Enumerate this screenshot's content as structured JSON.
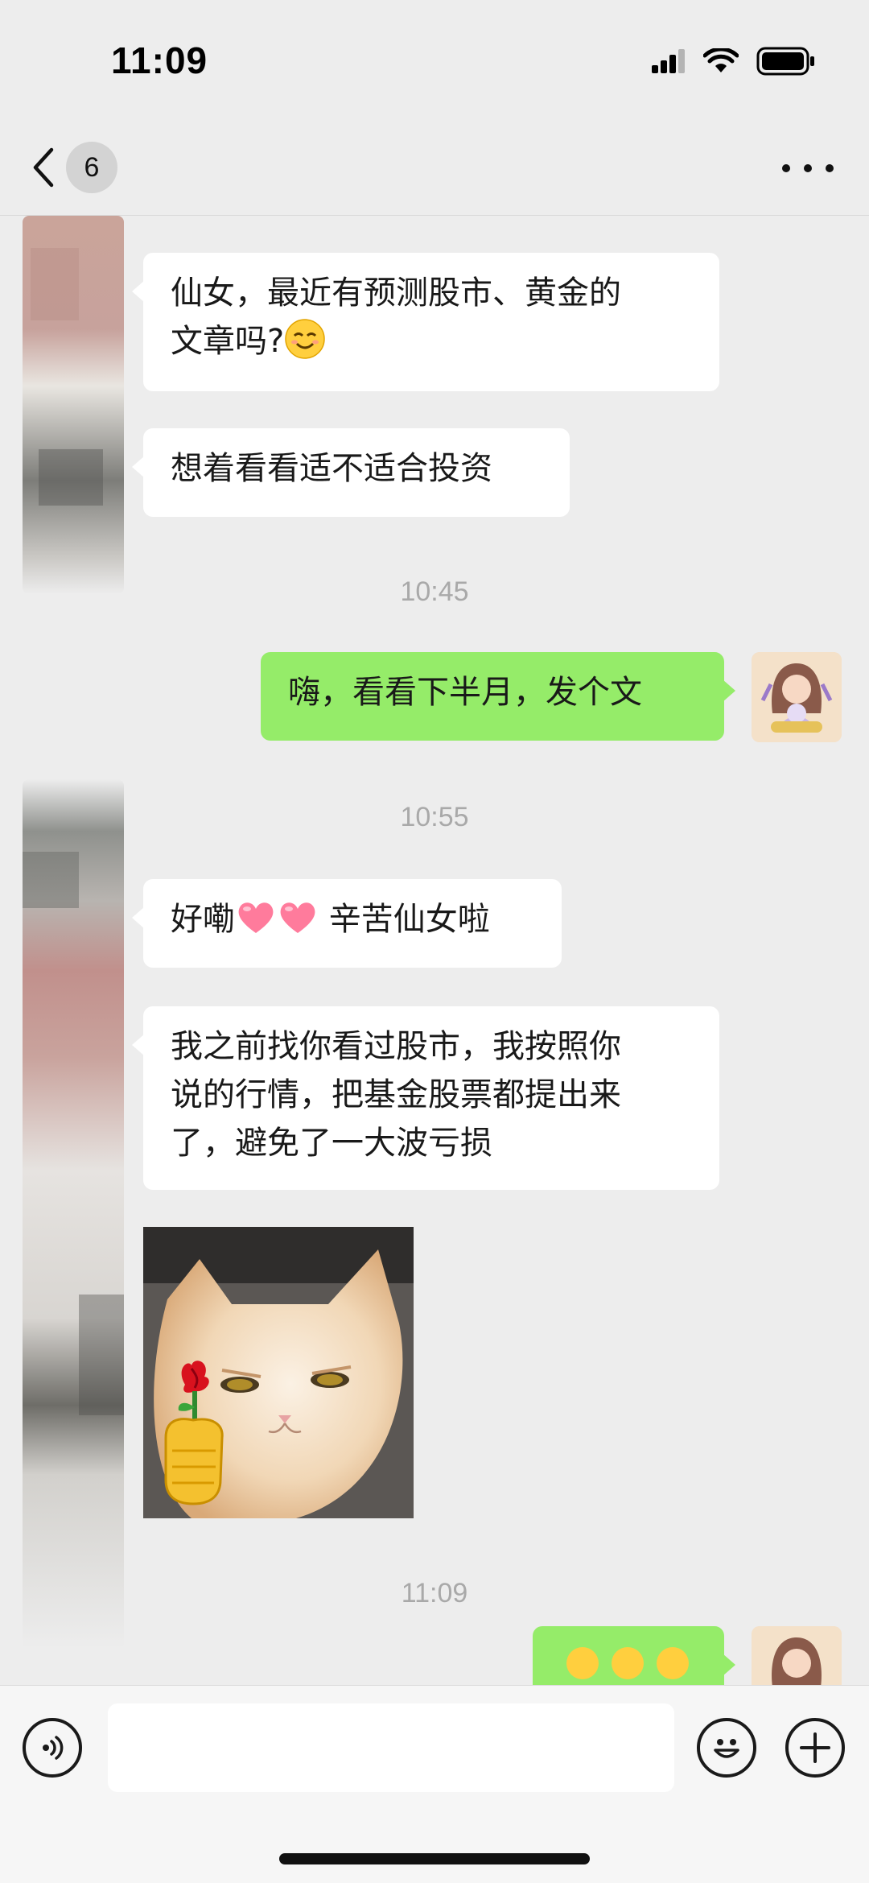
{
  "status_bar": {
    "time": "11:09"
  },
  "nav": {
    "back_count": "6"
  },
  "messages": {
    "m1_line1": "仙女，最近有预测股市、黄金的",
    "m1_line2": "文章吗?",
    "m2": "想着看看适不适合投资",
    "ts1": "10:45",
    "m3": "嗨，看看下半月，发个文",
    "ts2": "10:55",
    "m4_text": "辛苦仙女啦",
    "m4_prefix": "好嘞",
    "m5_line1": "我之前找你看过股市，我按照你",
    "m5_line2": "说的行情，把基金股票都提出来",
    "m5_line3": "了，避免了一大波亏损",
    "ts3": "11:09"
  },
  "input": {
    "value": ""
  },
  "icons": {
    "back": "chevron-left-icon",
    "more": "more-dots-icon",
    "voice": "voice-icon",
    "emoji": "emoji-icon",
    "plus": "plus-icon",
    "signal": "signal-icon",
    "wifi": "wifi-icon",
    "battery": "battery-icon",
    "heart": "heart-icon",
    "smile": "smile-emoji-icon"
  },
  "colors": {
    "background": "#ededed",
    "bubble_left": "#ffffff",
    "bubble_right": "#95ec69",
    "timestamp": "#a9a9a9"
  }
}
